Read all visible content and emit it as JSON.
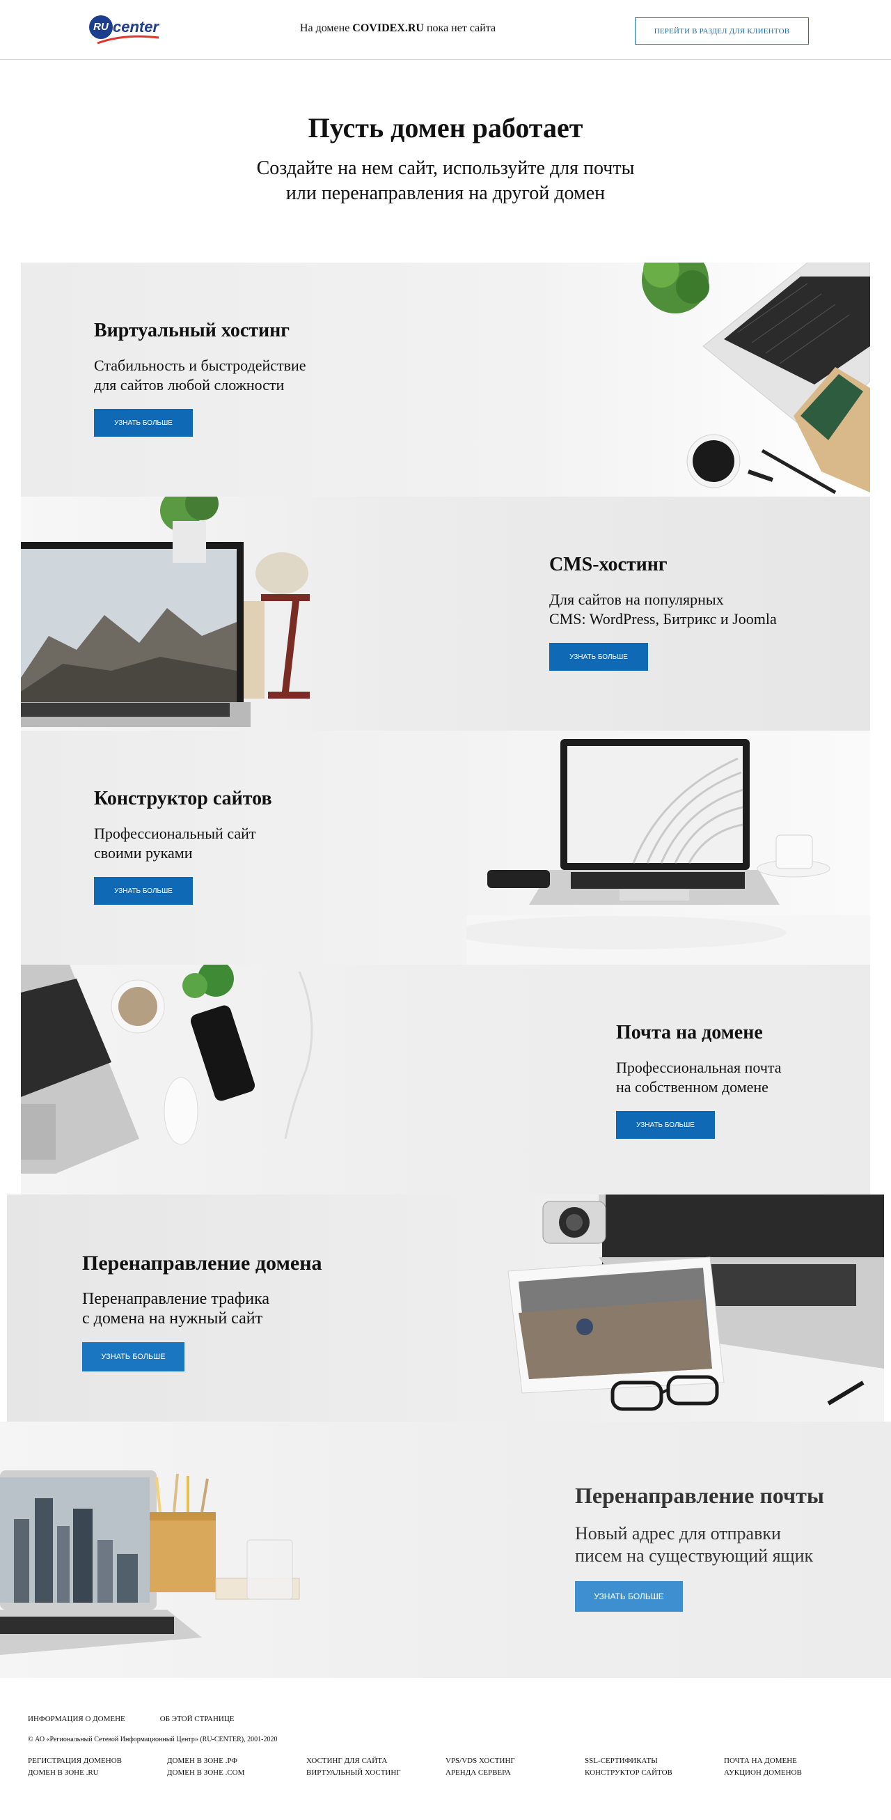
{
  "header": {
    "logo_ru": "RU",
    "logo_center": "center",
    "msg_prefix": "На домене ",
    "domain": "COVIDEX.RU",
    "msg_suffix": " пока нет сайта",
    "client_button": "ПЕРЕЙТИ В РАЗДЕЛ ДЛЯ КЛИЕНТОВ"
  },
  "hero": {
    "title": "Пусть домен работает",
    "subtitle_line1": "Создайте на нем сайт, используйте для почты",
    "subtitle_line2": "или перенаправления на другой домен"
  },
  "banners": [
    {
      "title": "Виртуальный хостинг",
      "line1": "Стабильность и быстродействие",
      "line2": "для сайтов любой сложности",
      "button": "УЗНАТЬ БОЛЬШЕ"
    },
    {
      "title": "CMS-хостинг",
      "line1": "Для сайтов на популярных",
      "line2": "CMS: WordPress, Битрикс и Joomla",
      "button": "УЗНАТЬ БОЛЬШЕ"
    },
    {
      "title": "Конструктор сайтов",
      "line1": "Профессиональный сайт",
      "line2": "своими руками",
      "button": "УЗНАТЬ БОЛЬШЕ"
    },
    {
      "title": "Почта на домене",
      "line1": "Профессиональная почта",
      "line2": "на собственном домене",
      "button": "УЗНАТЬ БОЛЬШЕ"
    },
    {
      "title": "Перенаправление домена",
      "line1": "Перенаправление трафика",
      "line2": "с домена на нужный сайт",
      "button": "УЗНАТЬ БОЛЬШЕ"
    },
    {
      "title": "Перенаправление почты",
      "line1": "Новый адрес для отправки",
      "line2": "писем на существующий ящик",
      "button": "УЗНАТЬ БОЛЬШЕ"
    }
  ],
  "footer": {
    "top_links": [
      "ИНФОРМАЦИЯ О ДОМЕНЕ",
      "ОБ ЭТОЙ СТРАНИЦЕ"
    ],
    "copyright": "© АО «Региональный Сетевой Информационный Центр» (RU-CENTER), 2001-2020",
    "columns": [
      [
        "РЕГИСТРАЦИЯ ДОМЕНОВ",
        "ДОМЕН В ЗОНЕ .RU"
      ],
      [
        "ДОМЕН В ЗОНЕ .РФ",
        "ДОМЕН В ЗОНЕ .COM"
      ],
      [
        "ХОСТИНГ ДЛЯ САЙТА",
        "ВИРТУАЛЬНЫЙ ХОСТИНГ"
      ],
      [
        "VPS/VDS ХОСТИНГ",
        "АРЕНДА СЕРВЕРА"
      ],
      [
        "SSL-СЕРТИФИКАТЫ",
        "КОНСТРУКТОР САЙТОВ"
      ],
      [
        "ПОЧТА НА ДОМЕНЕ",
        "АУКЦИОН ДОМЕНОВ"
      ]
    ]
  },
  "colors": {
    "accent": "#0f69b4",
    "logo": "#1d3e8d",
    "logo_swoosh": "#e0362c"
  }
}
